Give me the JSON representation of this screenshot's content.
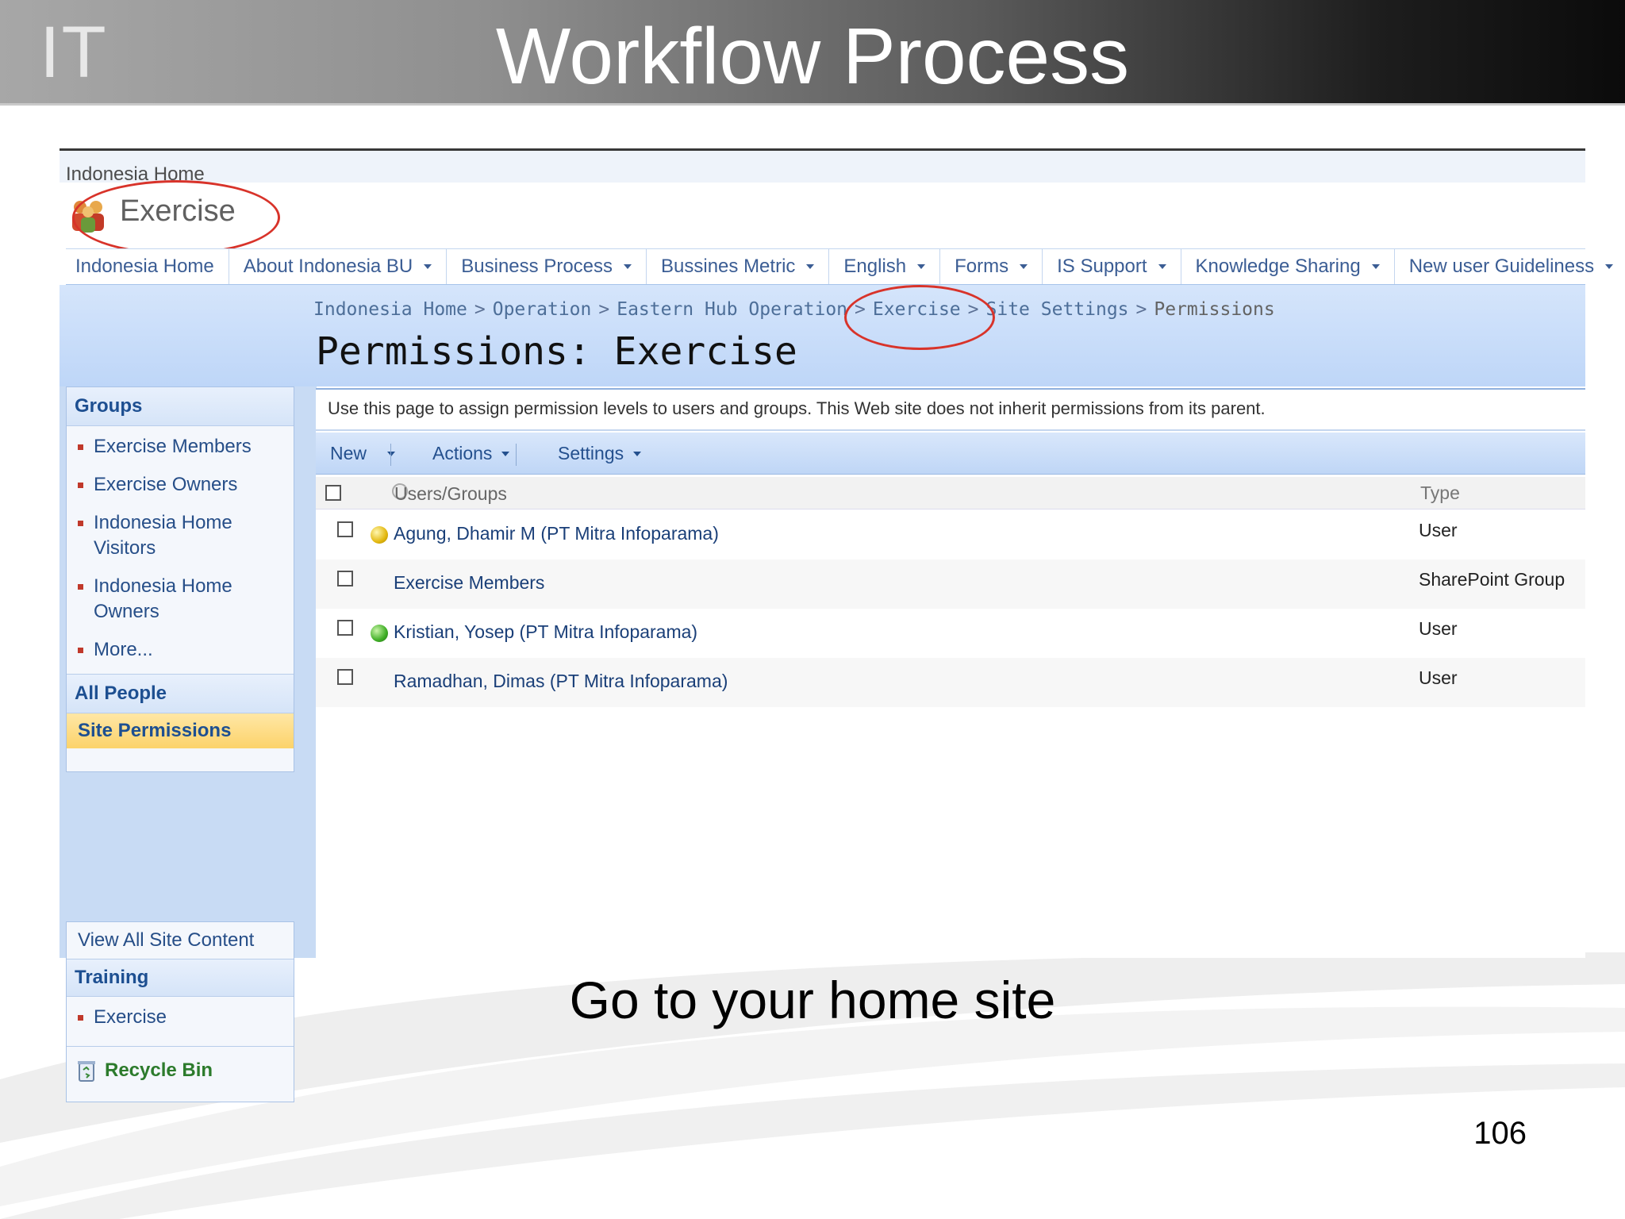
{
  "slide": {
    "brand": "IT",
    "title": "Workflow Process",
    "caption": "Go to your home site",
    "page_number": "106"
  },
  "site": {
    "top_link": "Indonesia Home",
    "title": "Exercise"
  },
  "topnav": [
    {
      "label": "Indonesia Home",
      "dropdown": false
    },
    {
      "label": "About Indonesia BU",
      "dropdown": true
    },
    {
      "label": "Business Process",
      "dropdown": true
    },
    {
      "label": "Bussines Metric",
      "dropdown": true
    },
    {
      "label": "English",
      "dropdown": true
    },
    {
      "label": "Forms",
      "dropdown": true
    },
    {
      "label": "IS Support",
      "dropdown": true
    },
    {
      "label": "Knowledge Sharing",
      "dropdown": true
    },
    {
      "label": "New user Guideliness",
      "dropdown": true
    }
  ],
  "breadcrumb": {
    "items": [
      "Indonesia Home",
      "Operation",
      "Eastern Hub Operation",
      "Exercise",
      "Site Settings"
    ],
    "current": "Permissions",
    "separator": ">"
  },
  "page_title": "Permissions: Exercise",
  "leftnav": {
    "groups_heading": "Groups",
    "groups": [
      "Exercise Members",
      "Exercise Owners",
      "Indonesia Home Visitors",
      "Indonesia Home Owners",
      "More..."
    ],
    "all_people": "All People",
    "site_permissions": "Site Permissions",
    "view_all": "View All Site Content",
    "training_heading": "Training",
    "training_items": [
      "Exercise"
    ],
    "recycle_bin": "Recycle Bin"
  },
  "description": "Use this page to assign permission levels to users and groups. This Web site does not inherit permissions from its parent.",
  "toolbar": {
    "new": "New",
    "actions": "Actions",
    "settings": "Settings"
  },
  "table": {
    "col_users": "Users/Groups",
    "col_type": "Type",
    "rows": [
      {
        "name": "Agung, Dhamir M (PT Mitra Infoparama)",
        "type": "User",
        "presence": "away"
      },
      {
        "name": "Exercise Members",
        "type": "SharePoint Group",
        "presence": "none"
      },
      {
        "name": "Kristian, Yosep (PT Mitra Infoparama)",
        "type": "User",
        "presence": "online"
      },
      {
        "name": "Ramadhan, Dimas (PT Mitra Infoparama)",
        "type": "User",
        "presence": "none"
      }
    ]
  },
  "colors": {
    "accent_red": "#d8332a",
    "link_blue": "#24508e",
    "presence_away": "#e3b80f",
    "presence_online": "#3fae26"
  }
}
